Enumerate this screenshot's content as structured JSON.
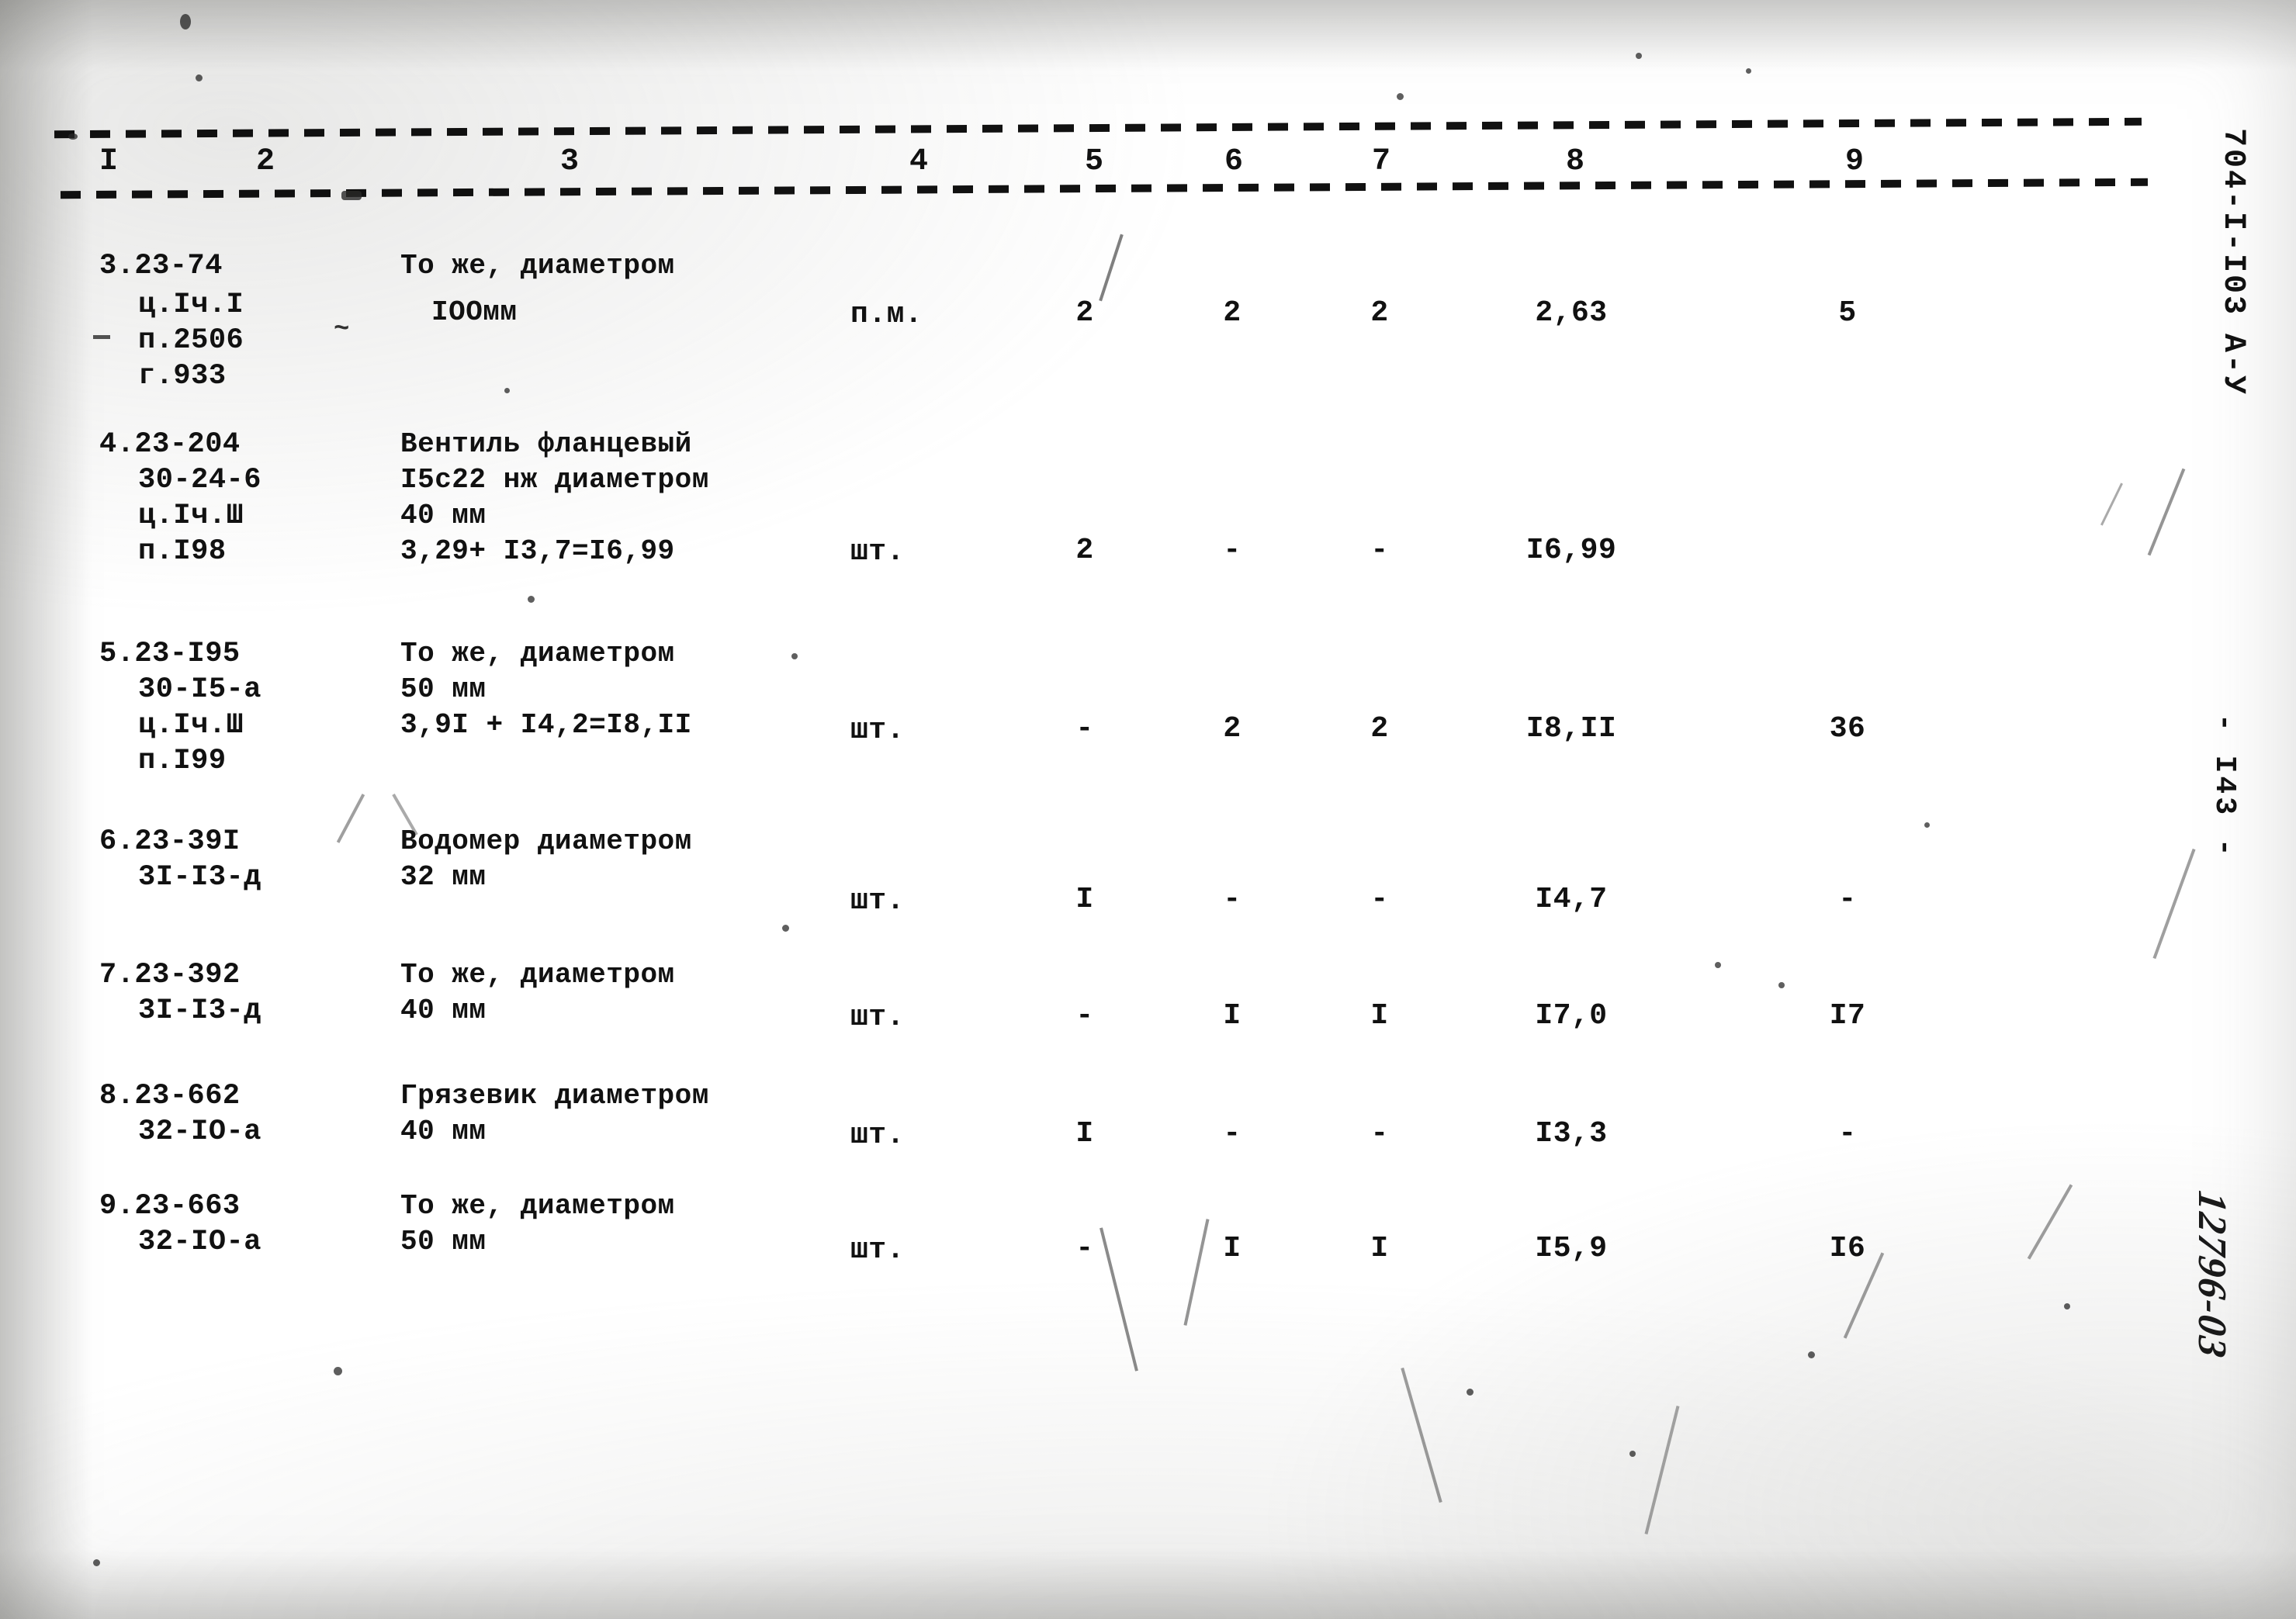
{
  "document": {
    "margin_right_top": "704-I-I03",
    "margin_right_series": "А-У",
    "margin_right_page": "- I43 -",
    "handwritten_note": "12796-03"
  },
  "table": {
    "column_numbers": [
      "I",
      "2",
      "3",
      "4",
      "5",
      "6",
      "7",
      "8",
      "9"
    ],
    "rows": [
      {
        "code_lines": [
          "3.23-74",
          "ц.Iч.I",
          "п.2506",
          "г.933"
        ],
        "desc_lines": [
          "То же, диаметром",
          "IOOмм"
        ],
        "unit": "п.м.",
        "c5": "2",
        "c6": "2",
        "c7": "2",
        "c8": "2,63",
        "c9": "5"
      },
      {
        "code_lines": [
          "4.23-204",
          "30-24-6",
          "ц.Iч.Ш",
          "п.I98"
        ],
        "desc_lines": [
          "Вентиль фланцевый",
          "I5с22 нж диаметром",
          "40 мм",
          "3,29+ I3,7=I6,99"
        ],
        "unit": "шт.",
        "c5": "2",
        "c6": "-",
        "c7": "-",
        "c8": "I6,99",
        "c9": ""
      },
      {
        "code_lines": [
          "5.23-I95",
          "30-I5-а",
          "ц.Iч.Ш",
          "п.I99"
        ],
        "desc_lines": [
          "То же, диаметром",
          "50 мм",
          "3,9I + I4,2=I8,II"
        ],
        "unit": "шт.",
        "c5": "-",
        "c6": "2",
        "c7": "2",
        "c8": "I8,II",
        "c9": "36"
      },
      {
        "code_lines": [
          "6.23-39I",
          "3I-I3-д"
        ],
        "desc_lines": [
          "Водомер диаметром",
          "32 мм"
        ],
        "unit": "шт.",
        "c5": "I",
        "c6": "-",
        "c7": "-",
        "c8": "I4,7",
        "c9": "-"
      },
      {
        "code_lines": [
          "7.23-392",
          "3I-I3-д"
        ],
        "desc_lines": [
          "То же, диаметром",
          "40 мм"
        ],
        "unit": "шт.",
        "c5": "-",
        "c6": "I",
        "c7": "I",
        "c8": "I7,0",
        "c9": "I7"
      },
      {
        "code_lines": [
          "8.23-662",
          "32-IO-а"
        ],
        "desc_lines": [
          "Грязевик диаметром",
          "40 мм"
        ],
        "unit": "шт.",
        "c5": "I",
        "c6": "-",
        "c7": "-",
        "c8": "I3,3",
        "c9": "-"
      },
      {
        "code_lines": [
          "9.23-663",
          "32-IO-а"
        ],
        "desc_lines": [
          "То же, диаметром",
          "50 мм"
        ],
        "unit": "шт.",
        "c5": "-",
        "c6": "I",
        "c7": "I",
        "c8": "I5,9",
        "c9": "I6"
      }
    ]
  }
}
